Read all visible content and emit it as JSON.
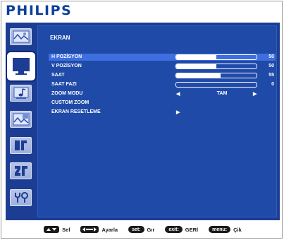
{
  "brand": "PHILIPS",
  "sidebar": {
    "items": [
      {
        "icon": "picture-icon",
        "active": false
      },
      {
        "icon": "screen-icon",
        "active": true
      },
      {
        "icon": "audio-icon",
        "active": false
      },
      {
        "icon": "pip-icon",
        "active": false
      },
      {
        "icon": "configuration1-icon",
        "active": false
      },
      {
        "icon": "configuration2-icon",
        "active": false
      },
      {
        "icon": "advanced-option-icon",
        "active": false
      }
    ]
  },
  "screen": {
    "title": "EKRAN",
    "items": [
      {
        "label": "H POZİSYON",
        "value": "50",
        "level": 0.5
      },
      {
        "label": "V POZİSYON",
        "value": "50",
        "level": 0.5
      },
      {
        "label": "SAAT",
        "value": "55",
        "level": 0.55
      },
      {
        "label": "SAAT FAZI",
        "value": "0",
        "level": 0
      },
      {
        "label": "ZOOM MODU",
        "option": "TAM"
      },
      {
        "label": "CUSTOM ZOOM"
      },
      {
        "label": "EKRAN RESETLEME"
      }
    ]
  },
  "footer": {
    "hints": [
      {
        "label": "Sel"
      },
      {
        "label": "Ayarla"
      },
      {
        "key": "set:",
        "label": "Gır"
      },
      {
        "key": "exit:",
        "label": "GERİ"
      },
      {
        "key": "menu:",
        "label": "Çik"
      }
    ]
  },
  "colors": {
    "brand": "#0a3f9e",
    "menu_background": "#1c3d92",
    "panel_background": "#1f4aa8",
    "selected_row": "#3e6ee0",
    "text": "#ffffff"
  }
}
